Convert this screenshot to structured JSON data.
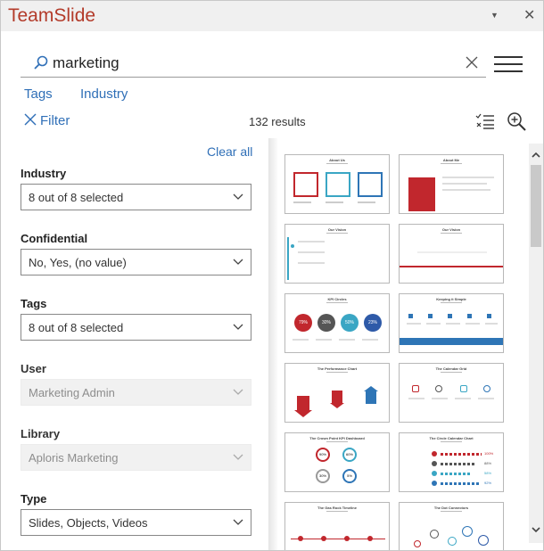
{
  "window": {
    "title": "TeamSlide",
    "dropdown_icon": "caret-down-icon",
    "close_icon": "close-icon"
  },
  "search": {
    "value": "marketing",
    "placeholder": "",
    "icon": "search-icon",
    "clear_icon": "clear-icon"
  },
  "menu_icon": "hamburger-menu-icon",
  "tabs": [
    {
      "label": "Tags"
    },
    {
      "label": "Industry"
    }
  ],
  "filter": {
    "label": "Filter",
    "icon": "close-icon"
  },
  "results_text": "132 results",
  "toolbar_icons": [
    "checklist-icon",
    "zoom-in-icon"
  ],
  "filters_panel": {
    "clear_all": "Clear all",
    "fields": [
      {
        "label": "Industry",
        "value": "8 out of 8 selected",
        "disabled": false
      },
      {
        "label": "Confidential",
        "value": "No, Yes, (no value)",
        "disabled": false
      },
      {
        "label": "Tags",
        "value": "8 out of 8 selected",
        "disabled": false
      },
      {
        "label": "User",
        "value": "Marketing Admin",
        "disabled": true
      },
      {
        "label": "Library",
        "value": "Aploris Marketing",
        "disabled": true
      },
      {
        "label": "Type",
        "value": "Slides, Objects, Videos",
        "disabled": false
      }
    ]
  },
  "slides": [
    {
      "title": "About Us"
    },
    {
      "title": "About Me"
    },
    {
      "title": "Our Vision"
    },
    {
      "title": "Our Vision"
    },
    {
      "title": "KPI Circles"
    },
    {
      "title": "Keeping it Simple"
    },
    {
      "title": "The Performance Chart"
    },
    {
      "title": "The Calendar Grid"
    },
    {
      "title": "The Crown Point KPI Dashboard"
    },
    {
      "title": "The Circle Calendar Chart"
    },
    {
      "title": "The Gas Rock Timeline"
    },
    {
      "title": "The Dot Connectors"
    }
  ],
  "slide_kpis": [
    "79%",
    "30%",
    "50%",
    "23%"
  ],
  "slide_kpis_b": [
    "90%",
    "60%",
    "30%",
    "5%"
  ],
  "slide_rates": [
    "100%",
    "88%",
    "58%",
    "92%"
  ],
  "colors": {
    "accent": "#2f6fb7",
    "brand": "#b33b2a",
    "slide_red": "#c1272d",
    "slide_blue": "#2e75b6"
  },
  "scroll": {
    "up_icon": "chevron-up-icon",
    "down_icon": "chevron-down-icon"
  }
}
